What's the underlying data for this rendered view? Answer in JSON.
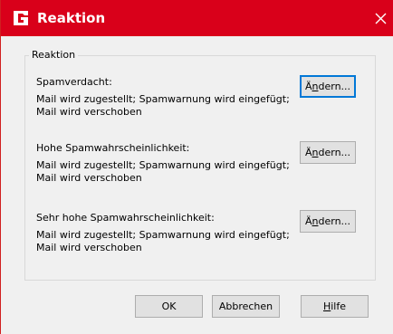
{
  "window": {
    "title": "Reaktion",
    "close_icon": "close-icon",
    "logo_icon": "gdata-logo-icon",
    "accent_color": "#d9001a"
  },
  "group": {
    "legend": "Reaktion"
  },
  "sections": [
    {
      "heading": "Spamverdacht:",
      "line1": "Mail wird zugestellt; Spamwarnung wird eingefügt;",
      "line2": "Mail wird verschoben",
      "button": {
        "pre": "Ä",
        "mid": "n",
        "post": "dern..."
      }
    },
    {
      "heading": "Hohe Spamwahrscheinlichkeit:",
      "line1": "Mail wird zugestellt; Spamwarnung wird eingefügt;",
      "line2": "Mail wird verschoben",
      "button": {
        "pre": "Ä",
        "mid": "n",
        "post": "dern..."
      }
    },
    {
      "heading": "Sehr hohe Spamwahrscheinlichkeit:",
      "line1": "Mail wird zugestellt; Spamwarnung wird eingefügt;",
      "line2": "Mail wird verschoben",
      "button": {
        "pre": "Ä",
        "mid": "n",
        "post": "dern..."
      }
    }
  ],
  "footer": {
    "ok_label": "OK",
    "cancel_label": "Abbrechen",
    "help_underlined": "H",
    "help_rest": "ilfe"
  }
}
